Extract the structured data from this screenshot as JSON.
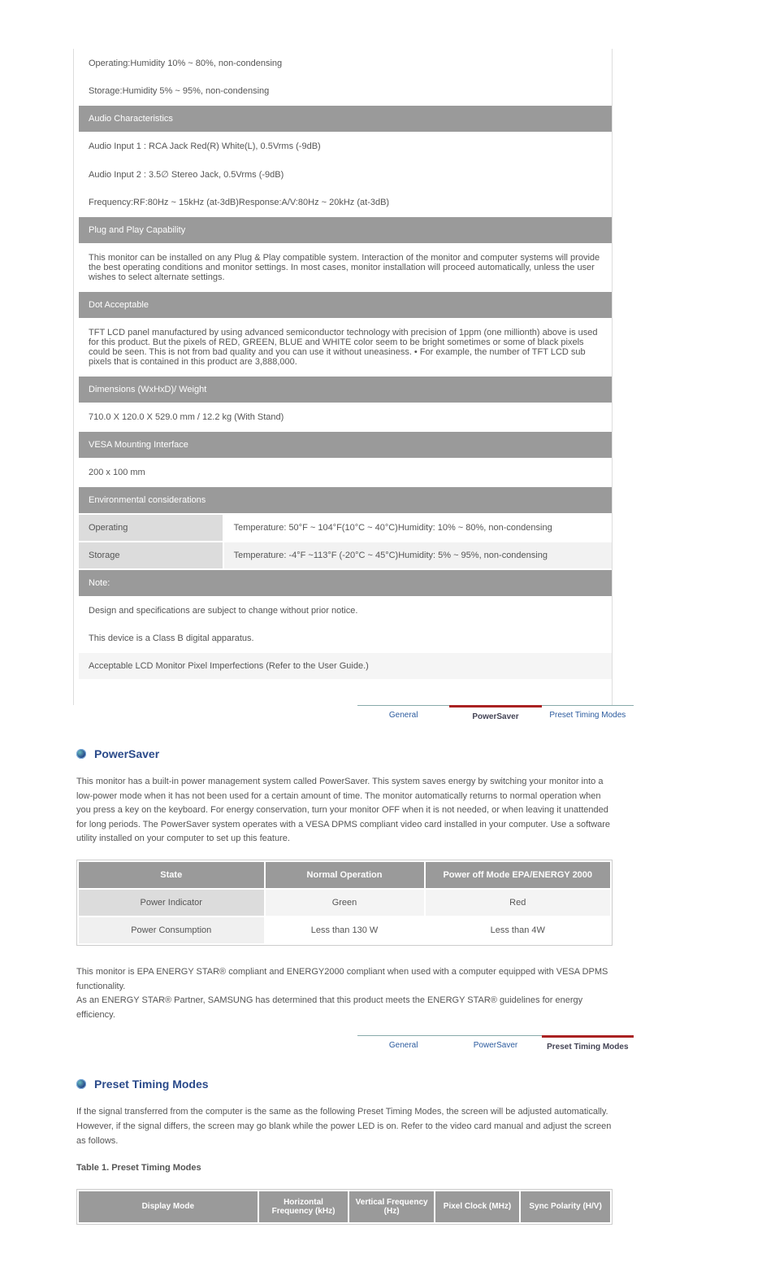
{
  "spec": {
    "rows": [
      {
        "type": "plain",
        "text": "Operating:Humidity 10% ~ 80%, non-condensing"
      },
      {
        "type": "plain",
        "text": "Storage:Humidity 5% ~ 95%, non-condensing"
      },
      {
        "type": "hdr",
        "text": "Audio Characteristics"
      },
      {
        "type": "plain",
        "text": "Audio Input 1 : RCA Jack Red(R) White(L), 0.5Vrms (-9dB)"
      },
      {
        "type": "plain",
        "text": "Audio Input 2 : 3.5∅ Stereo Jack, 0.5Vrms (-9dB)"
      },
      {
        "type": "plain",
        "text": "Frequency:RF:80Hz ~ 15kHz (at-3dB)Response:A/V:80Hz ~ 20kHz (at-3dB)"
      },
      {
        "type": "hdr",
        "text": "Plug and Play Capability"
      },
      {
        "type": "plain",
        "text": "This monitor can be installed on any Plug & Play compatible system. Interaction of the monitor and computer systems will provide the best operating conditions and monitor settings. In most cases, monitor installation will proceed automatically, unless the user wishes to select alternate settings."
      },
      {
        "type": "hdr",
        "text": "Dot Acceptable"
      },
      {
        "type": "plain",
        "text": "TFT LCD panel manufactured by using advanced semiconductor technology with precision of 1ppm (one millionth) above is used for this product. But the pixels of RED, GREEN, BLUE and WHITE color seem to be bright sometimes or some of black pixels could be seen. This is not from bad quality and you can use it without uneasiness.  • For example, the number of TFT LCD sub pixels that is contained in this product are 3,888,000."
      },
      {
        "type": "hdr",
        "text": "Dimensions (WxHxD)/ Weight"
      },
      {
        "type": "plain",
        "text": "710.0 X 120.0 X 529.0 mm / 12.2 kg (With Stand)"
      },
      {
        "type": "hdr",
        "text": "VESA Mounting Interface"
      },
      {
        "type": "plain",
        "text": "200 x 100 mm"
      },
      {
        "type": "hdr",
        "text": "Environmental considerations"
      },
      {
        "type": "kv",
        "label": "Operating",
        "value": "Temperature: 50°F ~ 104°F(10°C ~ 40°C)Humidity: 10% ~ 80%, non-condensing"
      },
      {
        "type": "kv",
        "label": "Storage",
        "value": "Temperature: -4°F ~113°F (-20°C ~ 45°C)Humidity: 5% ~ 95%, non-condensing"
      },
      {
        "type": "hdr",
        "text": "Note:"
      },
      {
        "type": "plain",
        "text": "Design and specifications are subject to change without prior notice."
      },
      {
        "type": "plain",
        "text": "This device is a Class B digital apparatus."
      },
      {
        "type": "lite",
        "text": "Acceptable LCD Monitor Pixel Imperfections (Refer to the User Guide.)"
      }
    ]
  },
  "tabs1": {
    "items": [
      "General",
      "PowerSaver",
      "Preset Timing Modes"
    ],
    "activeIndex": 1
  },
  "tabs2": {
    "items": [
      "General",
      "PowerSaver",
      "Preset Timing Modes"
    ],
    "activeIndex": 2
  },
  "powerSaver": {
    "title": "PowerSaver",
    "intro": "This monitor has a built-in power management system called PowerSaver. This system saves energy by switching your monitor into a low-power mode when it has not been used for a certain amount of time. The monitor automatically returns to normal operation when you press a key on the keyboard. For energy conservation, turn your monitor OFF when it is not needed, or when leaving it unattended for long periods. The PowerSaver system operates with a VESA DPMS compliant video card installed in your computer. Use a software utility installed on your computer to set up this feature.",
    "table": {
      "headers": [
        "State",
        "Normal Operation",
        "Power off Mode EPA/ENERGY 2000"
      ],
      "rows": [
        [
          "Power Indicator",
          "Green",
          "Red"
        ],
        [
          "Power Consumption",
          "Less than 130 W",
          "Less than 4W"
        ]
      ]
    },
    "footer": "This monitor is EPA ENERGY STAR® compliant and ENERGY2000 compliant when used with a computer equipped with VESA DPMS functionality.\nAs an ENERGY STAR® Partner, SAMSUNG has determined that this product meets the ENERGY STAR® guidelines for energy efficiency."
  },
  "presetTiming": {
    "title": "Preset Timing Modes",
    "intro": "If the signal transferred from the computer is the same as the following Preset Timing Modes, the screen will be adjusted automatically. However, if the signal differs, the screen may go blank while the power LED is on. Refer to the video card manual and adjust the screen as follows.",
    "caption": "Table 1. Preset Timing Modes",
    "headers": [
      "Display Mode",
      "Horizontal Frequency (kHz)",
      "Vertical Frequency (Hz)",
      "Pixel Clock (MHz)",
      "Sync Polarity (H/V)"
    ]
  },
  "chart_data": {
    "type": "table",
    "tables": [
      {
        "name": "PowerSaver",
        "columns": [
          "State",
          "Normal Operation",
          "Power off Mode EPA/ENERGY 2000"
        ],
        "rows": [
          [
            "Power Indicator",
            "Green",
            "Red"
          ],
          [
            "Power Consumption",
            "Less than 130 W",
            "Less than 4W"
          ]
        ]
      },
      {
        "name": "Preset Timing Modes (header only)",
        "columns": [
          "Display Mode",
          "Horizontal Frequency (kHz)",
          "Vertical Frequency (Hz)",
          "Pixel Clock (MHz)",
          "Sync Polarity (H/V)"
        ],
        "rows": []
      }
    ]
  }
}
